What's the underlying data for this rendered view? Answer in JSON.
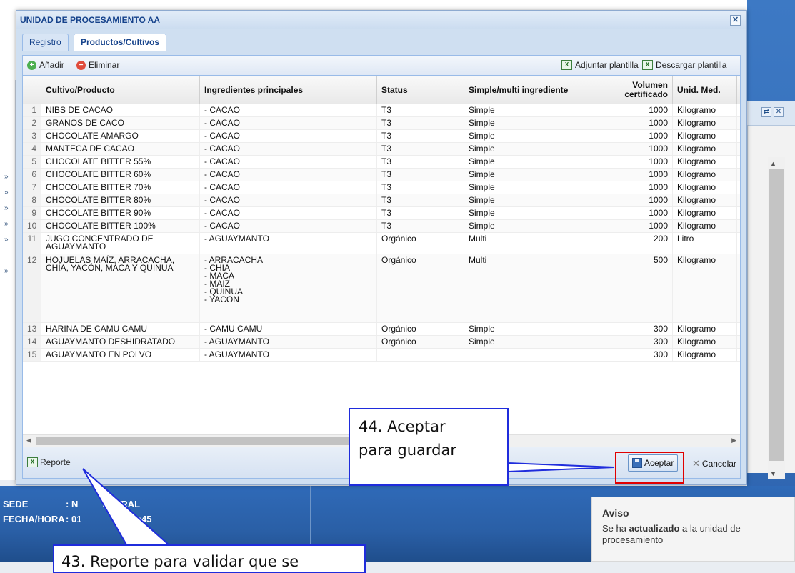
{
  "dialog": {
    "title": "UNIDAD DE PROCESAMIENTO AA",
    "tabs": [
      {
        "label": "Registro",
        "active": false
      },
      {
        "label": "Productos/Cultivos",
        "active": true
      }
    ]
  },
  "toolbar": {
    "add_label": "Añadir",
    "delete_label": "Eliminar",
    "attach_template_label": "Adjuntar plantilla",
    "download_template_label": "Descargar plantilla"
  },
  "grid": {
    "headers": {
      "cultivo": "Cultivo/Producto",
      "ingredientes": "Ingredientes principales",
      "status": "Status",
      "simple_multi": "Simple/multi ingrediente",
      "volumen": "Volumen certificado",
      "unidad": "Unid. Med."
    },
    "rows": [
      {
        "n": "1",
        "cultivo": "NIBS DE CACAO",
        "ingredientes": "- CACAO",
        "status": "T3",
        "tipo": "Simple",
        "volumen": "1000",
        "unidad": "Kilogramo"
      },
      {
        "n": "2",
        "cultivo": "GRANOS DE CACO",
        "ingredientes": "- CACAO",
        "status": "T3",
        "tipo": "Simple",
        "volumen": "1000",
        "unidad": "Kilogramo"
      },
      {
        "n": "3",
        "cultivo": "CHOCOLATE AMARGO",
        "ingredientes": "- CACAO",
        "status": "T3",
        "tipo": "Simple",
        "volumen": "1000",
        "unidad": "Kilogramo"
      },
      {
        "n": "4",
        "cultivo": "MANTECA DE CACAO",
        "ingredientes": "- CACAO",
        "status": "T3",
        "tipo": "Simple",
        "volumen": "1000",
        "unidad": "Kilogramo"
      },
      {
        "n": "5",
        "cultivo": "CHOCOLATE BITTER 55%",
        "ingredientes": "- CACAO",
        "status": "T3",
        "tipo": "Simple",
        "volumen": "1000",
        "unidad": "Kilogramo"
      },
      {
        "n": "6",
        "cultivo": "CHOCOLATE BITTER 60%",
        "ingredientes": "- CACAO",
        "status": "T3",
        "tipo": "Simple",
        "volumen": "1000",
        "unidad": "Kilogramo"
      },
      {
        "n": "7",
        "cultivo": "CHOCOLATE BITTER 70%",
        "ingredientes": "- CACAO",
        "status": "T3",
        "tipo": "Simple",
        "volumen": "1000",
        "unidad": "Kilogramo"
      },
      {
        "n": "8",
        "cultivo": "CHOCOLATE BITTER 80%",
        "ingredientes": "- CACAO",
        "status": "T3",
        "tipo": "Simple",
        "volumen": "1000",
        "unidad": "Kilogramo"
      },
      {
        "n": "9",
        "cultivo": "CHOCOLATE BITTER 90%",
        "ingredientes": "- CACAO",
        "status": "T3",
        "tipo": "Simple",
        "volumen": "1000",
        "unidad": "Kilogramo"
      },
      {
        "n": "10",
        "cultivo": "CHOCOLATE BITTER 100%",
        "ingredientes": "- CACAO",
        "status": "T3",
        "tipo": "Simple",
        "volumen": "1000",
        "unidad": "Kilogramo"
      },
      {
        "n": "11",
        "cultivo": "JUGO CONCENTRADO DE\nAGUAYMANTO",
        "ingredientes": "- AGUAYMANTO",
        "status": "Orgánico",
        "tipo": "Multi",
        "volumen": "200",
        "unidad": "Litro"
      },
      {
        "n": "12",
        "cultivo": "HOJUELAS MAÍZ, ARRACACHA,\nCHÍA, YACÓN, MACA Y QUINUA",
        "ingredientes": "- ARRACACHA\n- CHIA\n- MACA\n- MAIZ\n- QUINUA\n- YACON",
        "status": "Orgánico",
        "tipo": "Multi",
        "volumen": "500",
        "unidad": "Kilogramo"
      },
      {
        "n": "13",
        "cultivo": "HARINA DE CAMU CAMU",
        "ingredientes": "- CAMU CAMU",
        "status": "Orgánico",
        "tipo": "Simple",
        "volumen": "300",
        "unidad": "Kilogramo"
      },
      {
        "n": "14",
        "cultivo": "AGUAYMANTO DESHIDRATADO",
        "ingredientes": "- AGUAYMANTO",
        "status": "Orgánico",
        "tipo": "Simple",
        "volumen": "300",
        "unidad": "Kilogramo"
      },
      {
        "n": "15",
        "cultivo": "AGUAYMANTO EN POLVO",
        "ingredientes": "- AGUAYMANTO",
        "status": "",
        "tipo": "",
        "volumen": "300",
        "unidad": "Kilogramo"
      }
    ]
  },
  "footer": {
    "report_label": "Reporte",
    "accept_label": "Aceptar",
    "cancel_label": "Cancelar"
  },
  "annotations": {
    "accept_note_line1": "44. Aceptar",
    "accept_note_line2": "para guardar",
    "report_note": "43. Reporte para validar que se"
  },
  "background": {
    "info_sede_label": "SEDE",
    "info_sede_value": ": N",
    "info_sede_value2": "ENTRAL",
    "info_fecha_label": "FECHA/HORA",
    "info_fecha_value": ": 01",
    "info_fecha_value2": "03:10:45"
  },
  "notification": {
    "title": "Aviso",
    "msg_prefix": "Se ha ",
    "msg_bold": "actualizado",
    "msg_suffix": " a la unidad de procesamiento"
  },
  "colors": {
    "accent": "#15428b",
    "callout_border": "#1f2cdc",
    "highlight_box": "#e00000"
  }
}
